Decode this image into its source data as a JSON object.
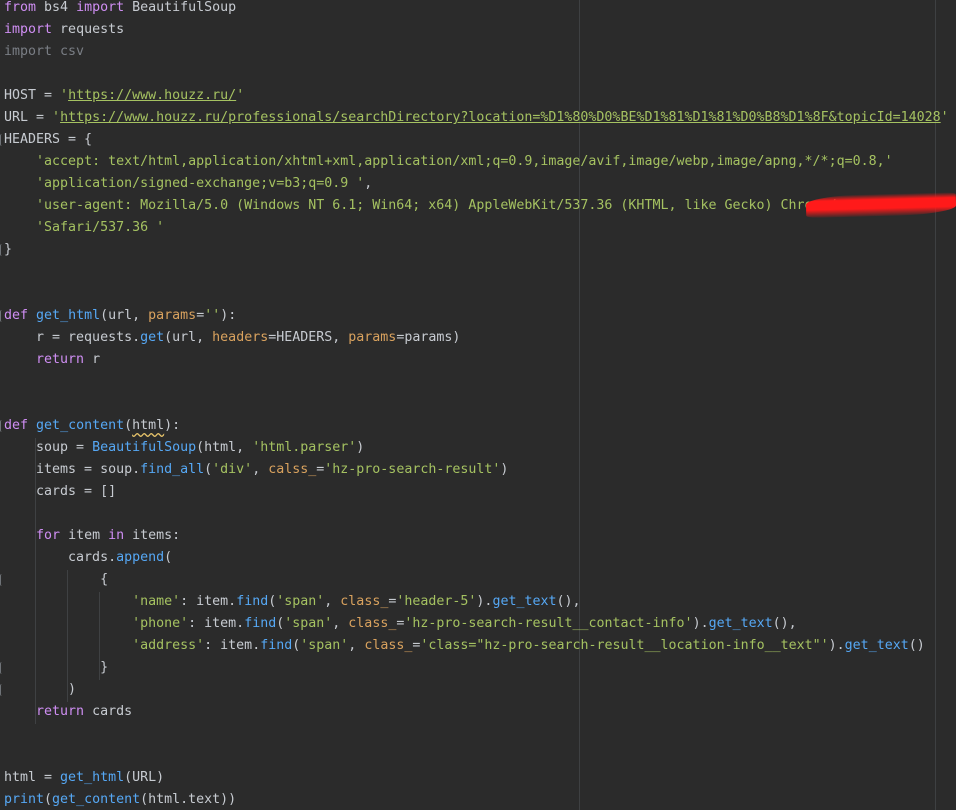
{
  "editor": {
    "lines": [
      {
        "row": 0,
        "tokens": [
          {
            "t": "from",
            "c": "kw"
          },
          {
            "t": " bs4 ",
            "c": ""
          },
          {
            "t": "import",
            "c": "kw"
          },
          {
            "t": " BeautifulSoup",
            "c": ""
          }
        ]
      },
      {
        "row": 1,
        "tokens": [
          {
            "t": "import",
            "c": "kw"
          },
          {
            "t": " requests",
            "c": ""
          }
        ]
      },
      {
        "row": 2,
        "tokens": [
          {
            "t": "import csv",
            "c": "dim"
          }
        ]
      },
      {
        "row": 4,
        "tokens": [
          {
            "t": "HOST = ",
            "c": ""
          },
          {
            "t": "'",
            "c": "str"
          },
          {
            "t": "https://www.houzz.ru/",
            "c": "url"
          },
          {
            "t": "'",
            "c": "str"
          }
        ]
      },
      {
        "row": 5,
        "tokens": [
          {
            "t": "URL = ",
            "c": ""
          },
          {
            "t": "'",
            "c": "str"
          },
          {
            "t": "https://www.houzz.ru/professionals/searchDirectory?location=%D1%80%D0%BE%D1%81%D1%81%D0%B8%D1%8F&topicId=14028",
            "c": "url"
          },
          {
            "t": "'",
            "c": "str"
          }
        ]
      },
      {
        "row": 6,
        "tokens": [
          {
            "t": "HEADERS = {",
            "c": ""
          }
        ]
      },
      {
        "row": 7,
        "tokens": [
          {
            "t": "    ",
            "c": ""
          },
          {
            "t": "'accept: text/html,application/xhtml+xml,application/xml;q=0.9,image/avif,image/webp,image/apng,*/*;q=0.8,'",
            "c": "str"
          }
        ]
      },
      {
        "row": 8,
        "tokens": [
          {
            "t": "    ",
            "c": ""
          },
          {
            "t": "'application/signed-exchange;v=b3;q=0.9 '",
            "c": "str"
          },
          {
            "t": ",",
            "c": ""
          }
        ]
      },
      {
        "row": 9,
        "tokens": [
          {
            "t": "    ",
            "c": ""
          },
          {
            "t": "'user-agent: Mozilla/5.0 (Windows NT 6.1; Win64; x64) AppleWebKit/537.36 (KHTML, like Gecko) Chrome/",
            "c": "str"
          }
        ]
      },
      {
        "row": 10,
        "tokens": [
          {
            "t": "    ",
            "c": ""
          },
          {
            "t": "'Safari/537.36 '",
            "c": "str"
          }
        ]
      },
      {
        "row": 11,
        "tokens": [
          {
            "t": "}",
            "c": ""
          }
        ]
      },
      {
        "row": 14,
        "tokens": [
          {
            "t": "def",
            "c": "kw"
          },
          {
            "t": " ",
            "c": ""
          },
          {
            "t": "get_html",
            "c": "fn"
          },
          {
            "t": "(url, ",
            "c": ""
          },
          {
            "t": "params",
            "c": "par"
          },
          {
            "t": "=",
            "c": ""
          },
          {
            "t": "''",
            "c": "str"
          },
          {
            "t": "):",
            "c": ""
          }
        ]
      },
      {
        "row": 15,
        "tokens": [
          {
            "t": "    r = requests.",
            "c": ""
          },
          {
            "t": "get",
            "c": "fn"
          },
          {
            "t": "(url, ",
            "c": ""
          },
          {
            "t": "headers",
            "c": "par"
          },
          {
            "t": "=HEADERS, ",
            "c": ""
          },
          {
            "t": "params",
            "c": "par"
          },
          {
            "t": "=params)",
            "c": ""
          }
        ]
      },
      {
        "row": 16,
        "tokens": [
          {
            "t": "    ",
            "c": ""
          },
          {
            "t": "return",
            "c": "kw"
          },
          {
            "t": " r",
            "c": ""
          }
        ]
      },
      {
        "row": 19,
        "tokens": [
          {
            "t": "def",
            "c": "kw"
          },
          {
            "t": " ",
            "c": ""
          },
          {
            "t": "get_content",
            "c": "fn"
          },
          {
            "t": "(",
            "c": ""
          },
          {
            "t": "html",
            "c": "squig"
          },
          {
            "t": "):",
            "c": ""
          }
        ]
      },
      {
        "row": 20,
        "tokens": [
          {
            "t": "    soup = ",
            "c": ""
          },
          {
            "t": "BeautifulSoup",
            "c": "fn"
          },
          {
            "t": "(html, ",
            "c": ""
          },
          {
            "t": "'html.parser'",
            "c": "str"
          },
          {
            "t": ")",
            "c": ""
          }
        ]
      },
      {
        "row": 21,
        "tokens": [
          {
            "t": "    items = soup.",
            "c": ""
          },
          {
            "t": "find_all",
            "c": "fn"
          },
          {
            "t": "(",
            "c": ""
          },
          {
            "t": "'div'",
            "c": "str"
          },
          {
            "t": ", ",
            "c": ""
          },
          {
            "t": "calss_",
            "c": "par"
          },
          {
            "t": "=",
            "c": ""
          },
          {
            "t": "'hz-pro-search-result'",
            "c": "str"
          },
          {
            "t": ")",
            "c": ""
          }
        ]
      },
      {
        "row": 22,
        "tokens": [
          {
            "t": "    cards = []",
            "c": ""
          }
        ]
      },
      {
        "row": 24,
        "tokens": [
          {
            "t": "    ",
            "c": ""
          },
          {
            "t": "for",
            "c": "kw"
          },
          {
            "t": " item ",
            "c": ""
          },
          {
            "t": "in",
            "c": "kw"
          },
          {
            "t": " items:",
            "c": ""
          }
        ]
      },
      {
        "row": 25,
        "tokens": [
          {
            "t": "        cards.",
            "c": ""
          },
          {
            "t": "append",
            "c": "fn"
          },
          {
            "t": "(",
            "c": ""
          }
        ]
      },
      {
        "row": 26,
        "tokens": [
          {
            "t": "            {",
            "c": ""
          }
        ]
      },
      {
        "row": 27,
        "tokens": [
          {
            "t": "                ",
            "c": ""
          },
          {
            "t": "'name'",
            "c": "str"
          },
          {
            "t": ": item.",
            "c": ""
          },
          {
            "t": "find",
            "c": "fn"
          },
          {
            "t": "(",
            "c": ""
          },
          {
            "t": "'span'",
            "c": "str"
          },
          {
            "t": ", ",
            "c": ""
          },
          {
            "t": "class_",
            "c": "par"
          },
          {
            "t": "=",
            "c": ""
          },
          {
            "t": "'header-5'",
            "c": "str"
          },
          {
            "t": ").",
            "c": ""
          },
          {
            "t": "get_text",
            "c": "fn"
          },
          {
            "t": "(),",
            "c": ""
          }
        ]
      },
      {
        "row": 28,
        "tokens": [
          {
            "t": "                ",
            "c": ""
          },
          {
            "t": "'phone'",
            "c": "str"
          },
          {
            "t": ": item.",
            "c": ""
          },
          {
            "t": "find",
            "c": "fn"
          },
          {
            "t": "(",
            "c": ""
          },
          {
            "t": "'span'",
            "c": "str"
          },
          {
            "t": ", ",
            "c": ""
          },
          {
            "t": "class_",
            "c": "par"
          },
          {
            "t": "=",
            "c": ""
          },
          {
            "t": "'hz-pro-search-result__contact-info'",
            "c": "str"
          },
          {
            "t": ").",
            "c": ""
          },
          {
            "t": "get_text",
            "c": "fn"
          },
          {
            "t": "(),",
            "c": ""
          }
        ]
      },
      {
        "row": 29,
        "tokens": [
          {
            "t": "                ",
            "c": ""
          },
          {
            "t": "'address'",
            "c": "str"
          },
          {
            "t": ": item.",
            "c": ""
          },
          {
            "t": "find",
            "c": "fn"
          },
          {
            "t": "(",
            "c": ""
          },
          {
            "t": "'span'",
            "c": "str"
          },
          {
            "t": ", ",
            "c": ""
          },
          {
            "t": "class_",
            "c": "par"
          },
          {
            "t": "=",
            "c": ""
          },
          {
            "t": "'class=\"hz-pro-search-result__location-info__text\"'",
            "c": "str"
          },
          {
            "t": ").",
            "c": ""
          },
          {
            "t": "get_text",
            "c": "fn"
          },
          {
            "t": "()",
            "c": ""
          }
        ]
      },
      {
        "row": 30,
        "tokens": [
          {
            "t": "            }",
            "c": ""
          }
        ]
      },
      {
        "row": 31,
        "tokens": [
          {
            "t": "        )",
            "c": ""
          }
        ]
      },
      {
        "row": 32,
        "tokens": [
          {
            "t": "    ",
            "c": ""
          },
          {
            "t": "return",
            "c": "kw"
          },
          {
            "t": " cards",
            "c": ""
          }
        ]
      },
      {
        "row": 35,
        "tokens": [
          {
            "t": "html = ",
            "c": ""
          },
          {
            "t": "get_html",
            "c": "fn"
          },
          {
            "t": "(URL)",
            "c": ""
          }
        ]
      },
      {
        "row": 36,
        "tokens": [
          {
            "t": "print",
            "c": "fn"
          },
          {
            "t": "(",
            "c": ""
          },
          {
            "t": "get_content",
            "c": "fn"
          },
          {
            "t": "(html.text))",
            "c": ""
          }
        ]
      }
    ]
  }
}
